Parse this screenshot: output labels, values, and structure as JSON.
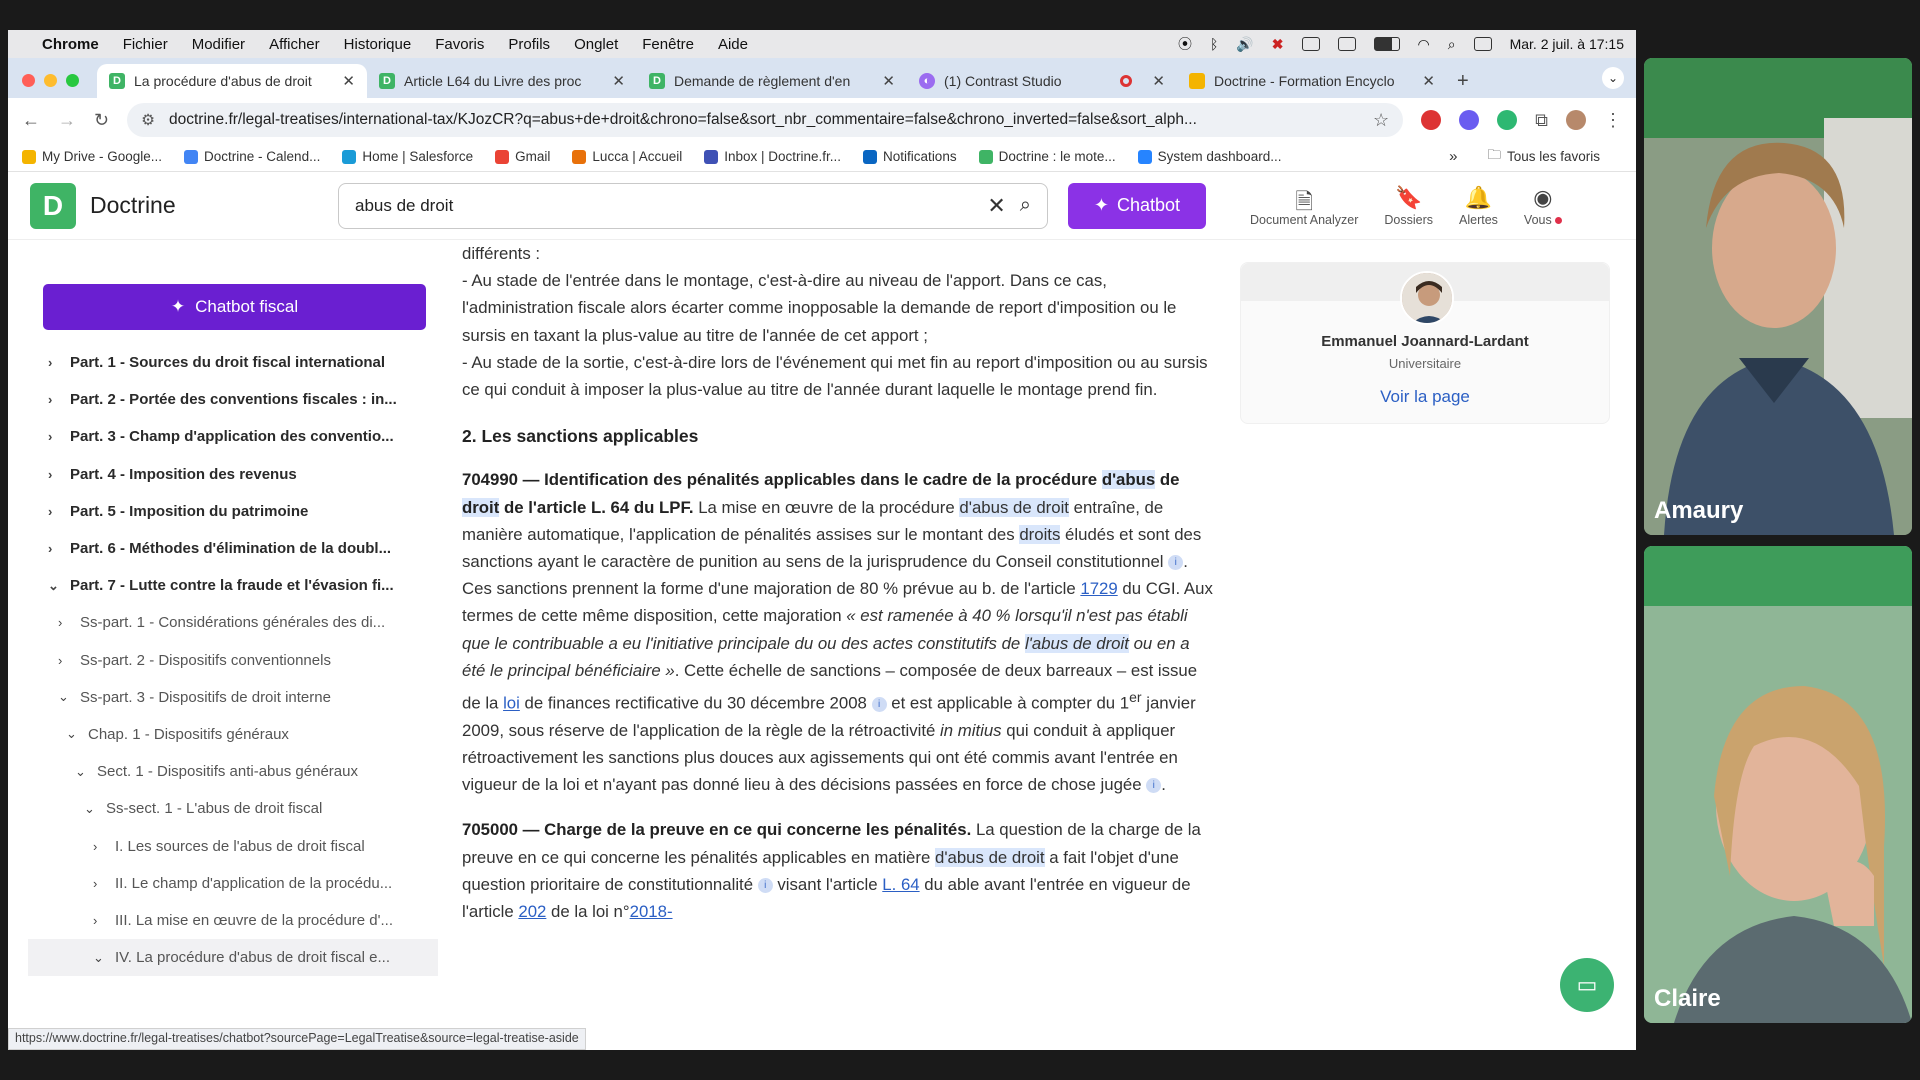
{
  "menubar": {
    "app": "Chrome",
    "items": [
      "Fichier",
      "Modifier",
      "Afficher",
      "Historique",
      "Favoris",
      "Profils",
      "Onglet",
      "Fenêtre",
      "Aide"
    ],
    "datetime": "Mar. 2 juil. à 17:15"
  },
  "tabs": [
    {
      "title": "La procédure d'abus de droit",
      "icon": "doctrine-icon",
      "active": true
    },
    {
      "title": "Article L64 du Livre des proc",
      "icon": "doctrine-icon"
    },
    {
      "title": "Demande de règlement d'en",
      "icon": "doctrine-icon"
    },
    {
      "title": "(1) Contrast Studio",
      "icon": "contrast-icon"
    },
    {
      "title": "Doctrine - Formation Encyclo",
      "icon": "slides-icon"
    }
  ],
  "address": {
    "url": "doctrine.fr/legal-treatises/international-tax/KJozCR?q=abus+de+droit&chrono=false&sort_nbr_commentaire=false&chrono_inverted=false&sort_alph..."
  },
  "bookmarks": [
    {
      "label": "My Drive - Google...",
      "color": "#f4b400"
    },
    {
      "label": "Doctrine - Calend...",
      "color": "#4285f4"
    },
    {
      "label": "Home | Salesforce",
      "color": "#1a9bd7"
    },
    {
      "label": "Gmail",
      "color": "#ea4335"
    },
    {
      "label": "Lucca | Accueil",
      "color": "#e8710a"
    },
    {
      "label": "Inbox | Doctrine.fr...",
      "color": "#3f51b5"
    },
    {
      "label": "Notifications",
      "color": "#0a66c2"
    },
    {
      "label": "Doctrine : le mote...",
      "color": "#3fb465"
    },
    {
      "label": "System dashboard...",
      "color": "#2684ff"
    }
  ],
  "bookmarks_more": "»",
  "bookmarks_all": "Tous les favoris",
  "header": {
    "logo_letter": "D",
    "brand": "Doctrine",
    "search_value": "abus de droit",
    "chatbot_label": "Chatbot",
    "nav": [
      {
        "label": "Document Analyzer",
        "icon": "document-search-icon"
      },
      {
        "label": "Dossiers",
        "icon": "bookmark-icon"
      },
      {
        "label": "Alertes",
        "icon": "bell-icon"
      },
      {
        "label": "Vous",
        "icon": "user-icon"
      }
    ]
  },
  "sidebar": {
    "cta": "Chatbot fiscal",
    "toc": [
      {
        "label": "Part. 1 - Sources du droit fiscal international",
        "level": 0,
        "chev": "›"
      },
      {
        "label": "Part. 2 - Portée des conventions fiscales : in...",
        "level": 0,
        "chev": "›"
      },
      {
        "label": "Part. 3 - Champ d'application des conventio...",
        "level": 0,
        "chev": "›"
      },
      {
        "label": "Part. 4 - Imposition des revenus",
        "level": 0,
        "chev": "›"
      },
      {
        "label": "Part. 5 - Imposition du patrimoine",
        "level": 0,
        "chev": "›"
      },
      {
        "label": "Part. 6 - Méthodes d'élimination de la doubl...",
        "level": 0,
        "chev": "›"
      },
      {
        "label": "Part. 7 - Lutte contre la fraude et l'évasion fi...",
        "level": 0,
        "chev": "⌄"
      },
      {
        "label": "Ss-part. 1 - Considérations générales des di...",
        "level": 1,
        "chev": "›"
      },
      {
        "label": "Ss-part. 2 - Dispositifs conventionnels",
        "level": 1,
        "chev": "›"
      },
      {
        "label": "Ss-part. 3 - Dispositifs de droit interne",
        "level": 1,
        "chev": "⌄"
      },
      {
        "label": "Chap. 1 - Dispositifs généraux",
        "level": 2,
        "chev": "⌄"
      },
      {
        "label": "Sect. 1 - Dispositifs anti-abus généraux",
        "level": 3,
        "chev": "⌄"
      },
      {
        "label": "Ss-sect. 1 - L'abus de droit fiscal",
        "level": 4,
        "chev": "⌄"
      },
      {
        "label": "I. Les sources de l'abus de droit fiscal",
        "level": 5,
        "chev": "›"
      },
      {
        "label": "II. Le champ d'application de la procédu...",
        "level": 5,
        "chev": "›"
      },
      {
        "label": "III. La mise en œuvre de la procédure d'...",
        "level": 5,
        "chev": "›"
      },
      {
        "label": "IV. La procédure d'abus de droit fiscal e...",
        "level": 5,
        "chev": "⌄",
        "selected": true
      }
    ]
  },
  "content": {
    "intro": "différents :",
    "bullet1": "- Au stade de l'entrée dans le montage, c'est-à-dire au niveau de l'apport. Dans ce cas, l'administration fiscale alors écarter comme inopposable la demande de report d'imposition ou le sursis en taxant la plus-value au titre de l'année de cet apport ;",
    "bullet2": "- Au stade de la sortie, c'est-à-dire lors de l'événement qui met fin au report d'imposition ou au sursis ce qui conduit à imposer la plus-value au titre de l'année durant laquelle le montage prend fin.",
    "heading": "2. Les sanctions applicables",
    "p1": {
      "title_a": "704990 — Identification des pénalités applicables dans le cadre de la procédure",
      "hl_abus": "d'abus",
      "de": "de",
      "hl_droit": "droit",
      "title_b": "de l'article L. 64 du LPF.",
      "t1": "La mise en œuvre de la procédure",
      "hl1": "d'abus de droit",
      "t2": "entraîne, de manière automatique, l'application de pénalités assises sur le montant des",
      "hl2": "droits",
      "t3": "éludés et sont des sanctions ayant le caractère de punition au sens de la jurisprudence du Conseil constitutionnel",
      "t4": ". Ces sanctions prennent la forme d'une majoration de 80 % prévue au b. de l'article",
      "link1729": "1729",
      "t5": "du CGI. Aux termes de cette même disposition, cette majoration",
      "q1": "« est ramenée à 40 % lorsqu'il n'est pas établi que le contribuable a eu l'initiative principale du ou des actes constitutifs de",
      "hl3": "l'abus de droit",
      "q2": "ou en a été le principal bénéficiaire »",
      "t6": ". Cette échelle de sanctions – composée de deux barreaux – est issue de la",
      "link_loi": "loi",
      "t7": "de finances rectificative du 30 décembre 2008",
      "t8": "et est applicable à compter du 1",
      "sup": "er",
      "t9": "janvier 2009, sous réserve de l'application de la règle de la rétroactivité",
      "em1": "in mitius",
      "t10": "qui conduit à appliquer rétroactivement les sanctions plus douces aux agissements qui ont été commis avant l'entrée en vigueur de la loi et n'ayant pas donné lieu à des décisions passées en force de chose jugée",
      "end": "."
    },
    "p2": {
      "title": "705000 — Charge de la preuve en ce qui concerne les pénalités.",
      "t1": "La question de la charge de la preuve en ce qui concerne les pénalités applicables en matière",
      "hl1": "d'abus de droit",
      "t2": "a fait l'objet d'une question prioritaire de constitutionnalité",
      "t3": "visant l'article",
      "link_l64": "L. 64",
      "t4": "du",
      "t5": "able avant l'entrée en vigueur de l'article",
      "link202": "202",
      "t6": "de la loi n°",
      "link2018": "2018-"
    },
    "info_glyph": "i"
  },
  "author": {
    "name": "Emmanuel Joannard-Lardant",
    "role": "Universitaire",
    "link": "Voir la page"
  },
  "statusbar": "https://www.doctrine.fr/legal-treatises/chatbot?sourcePage=LegalTreatise&source=legal-treatise-aside",
  "participants": [
    {
      "name": "Amaury"
    },
    {
      "name": "Claire"
    }
  ]
}
